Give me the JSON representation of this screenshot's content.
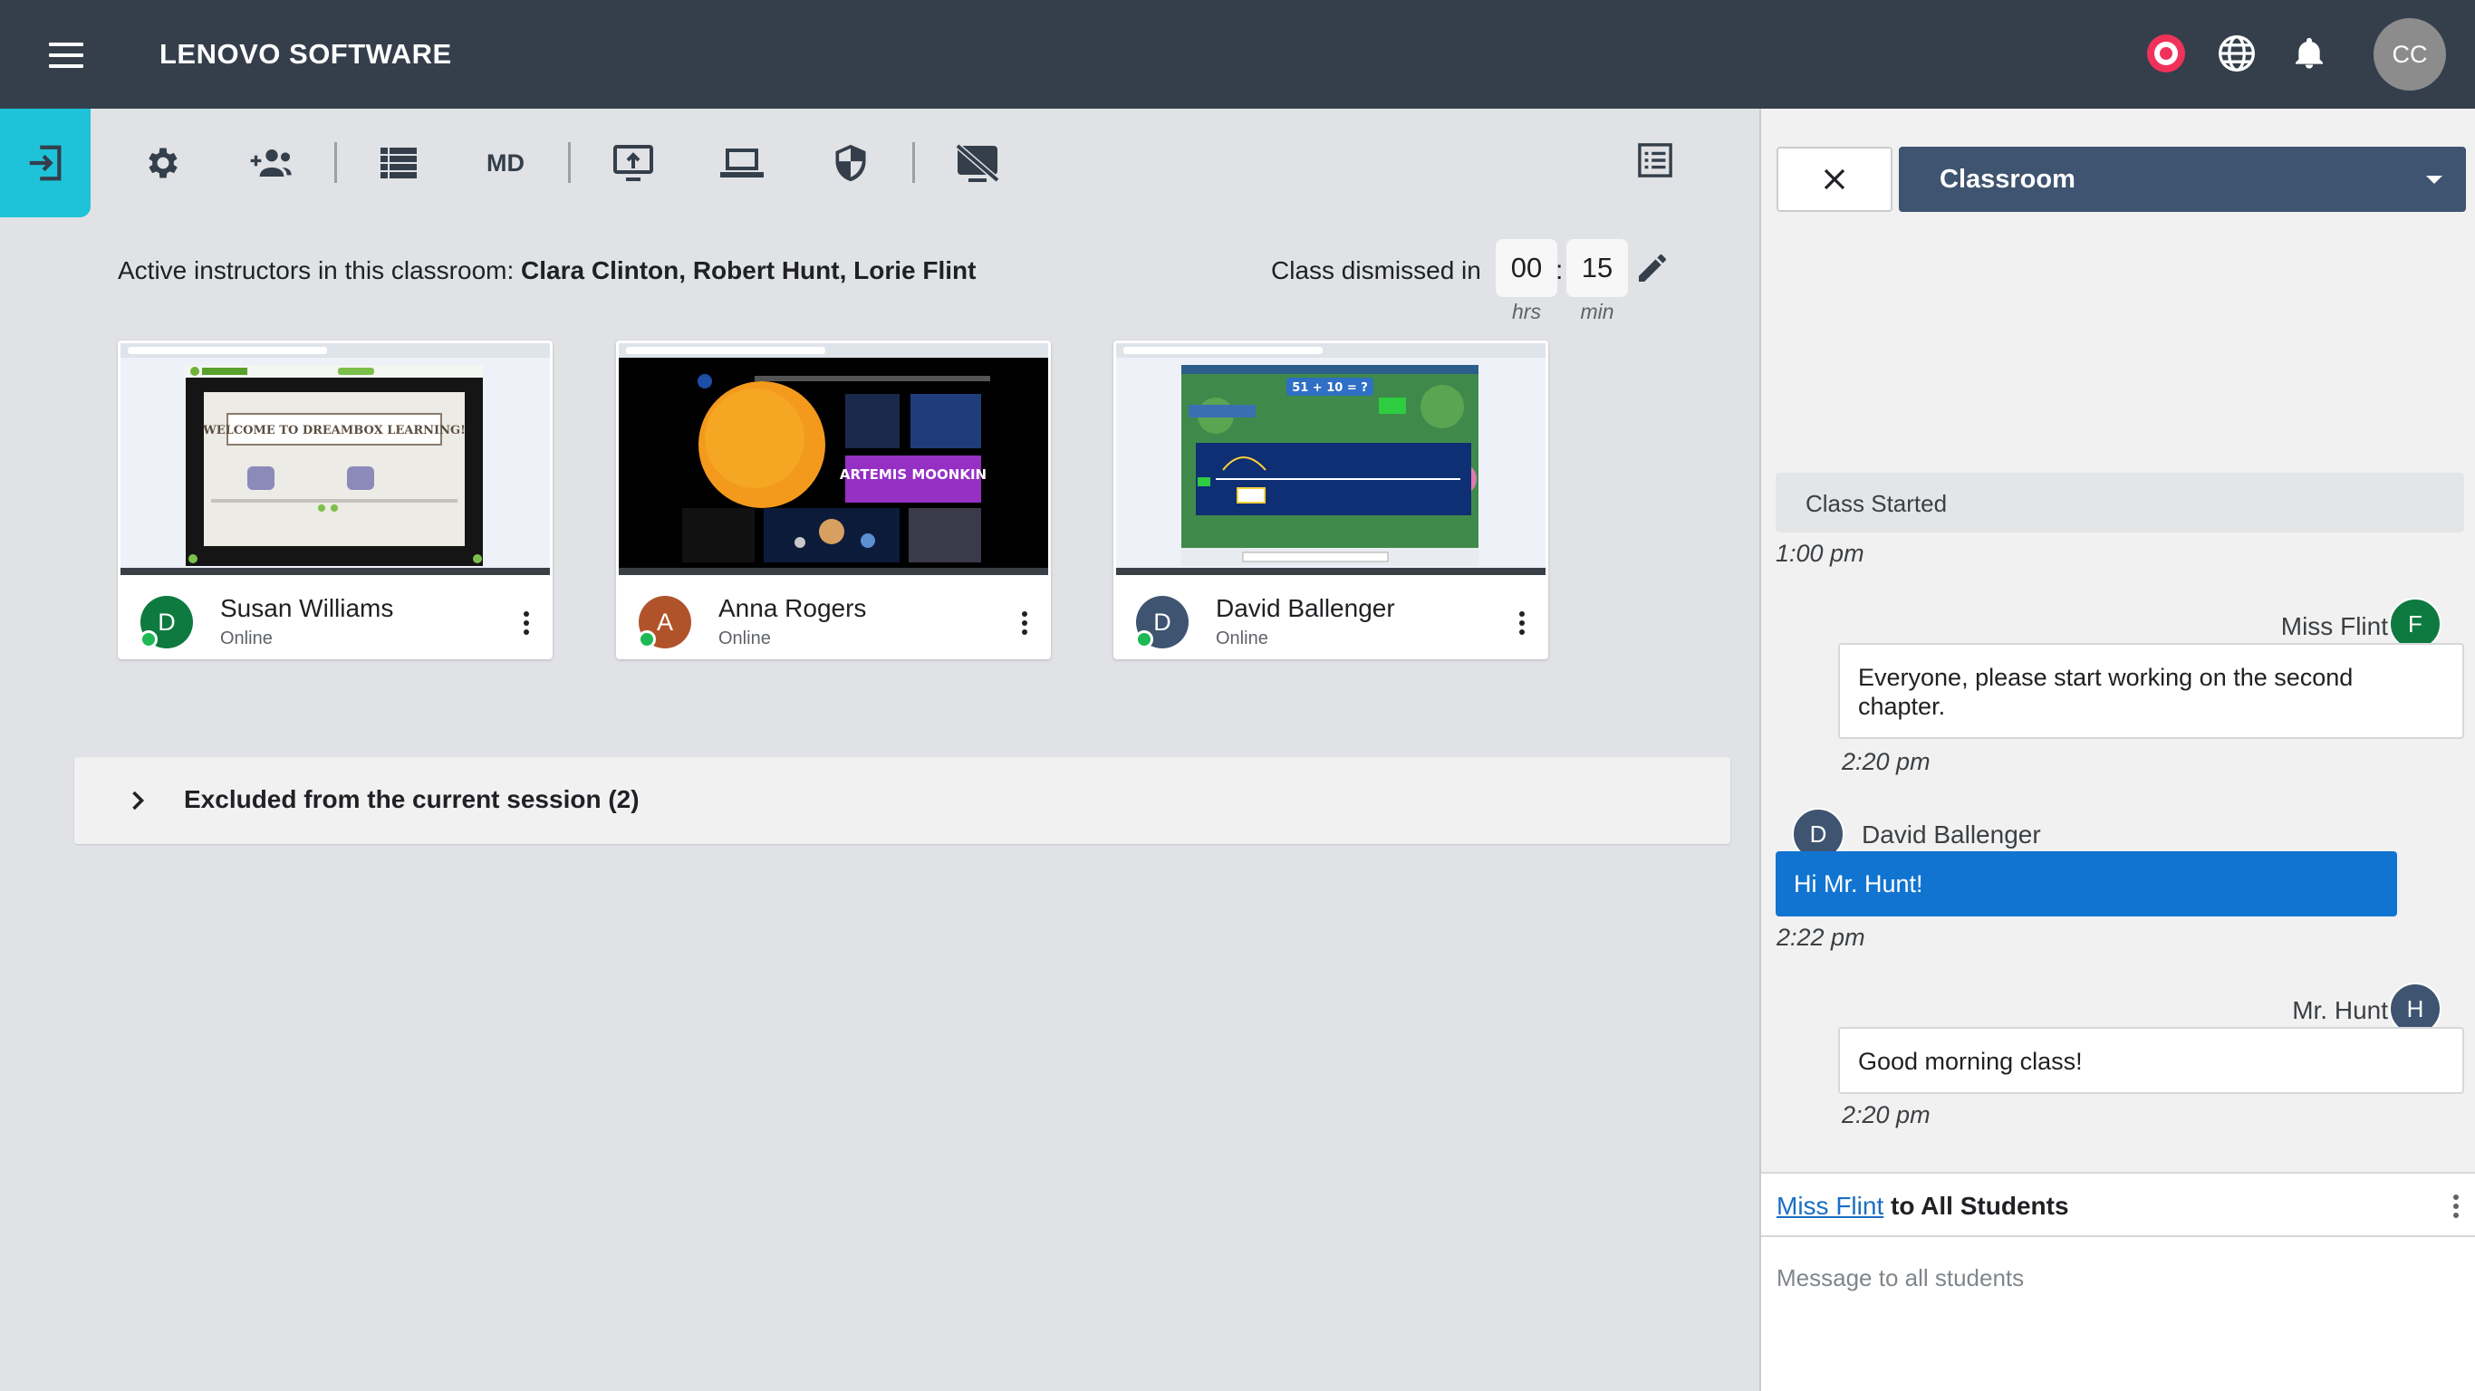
{
  "app": {
    "title": "LENOVO SOFTWARE",
    "user_initials": "CC"
  },
  "topbar_icons": [
    "menu-icon",
    "record-icon",
    "globe-icon",
    "bell-icon"
  ],
  "toolbar": {
    "md_label": "MD",
    "icons": [
      "exit-icon",
      "gear-icon",
      "group-add-icon",
      "list-icon",
      "share-screen-icon",
      "laptop-icon",
      "shield-icon",
      "screen-off-icon",
      "notes-icon"
    ]
  },
  "session": {
    "instructors_prefix": "Active instructors in this classroom:",
    "instructors_names": "Clara Clinton, Robert Hunt, Lorie Flint",
    "dismiss_label": "Class dismissed in",
    "hours": "00",
    "minutes": "15",
    "hrs_label": "hrs",
    "min_label": "min"
  },
  "students": [
    {
      "name": "Susan Williams",
      "status": "Online",
      "initial": "D",
      "avatar_color": "#0e7a3f",
      "screen_text": "WELCOME TO DREAMBOX LEARNING!"
    },
    {
      "name": "Anna Rogers",
      "status": "Online",
      "initial": "A",
      "avatar_color": "#b0532b",
      "screen_text": "ARTEMIS MOONKIN"
    },
    {
      "name": "David Ballenger",
      "status": "Online",
      "initial": "D",
      "avatar_color": "#3e5470",
      "screen_text": "51 + 10 = ?"
    }
  ],
  "excluded": {
    "label": "Excluded from the current session (2)"
  },
  "chat": {
    "room": "Classroom",
    "system_message": "Class Started",
    "system_time": "1:00 pm",
    "messages": [
      {
        "sender": "Miss Flint",
        "initial": "F",
        "avatar_color": "#0e7a3f",
        "text": "Everyone, please start working on the second chapter.",
        "time": "2:20 pm"
      },
      {
        "sender": "David Ballenger",
        "initial": "D",
        "avatar_color": "#3e5470",
        "text": "Hi Mr. Hunt!",
        "time": "2:22 pm"
      },
      {
        "sender": "Mr. Hunt",
        "initial": "H",
        "avatar_color": "#3e5470",
        "text": "Good morning class!",
        "time": "2:20 pm"
      }
    ],
    "compose_from": "Miss Flint",
    "compose_to": "to All Students",
    "compose_placeholder": "Message to all students"
  },
  "colors": {
    "topbar": "#343f4b",
    "accent": "#1ec3d9",
    "record": "#f0325a",
    "primary": "#1274d1",
    "room_select": "#3e5470"
  }
}
